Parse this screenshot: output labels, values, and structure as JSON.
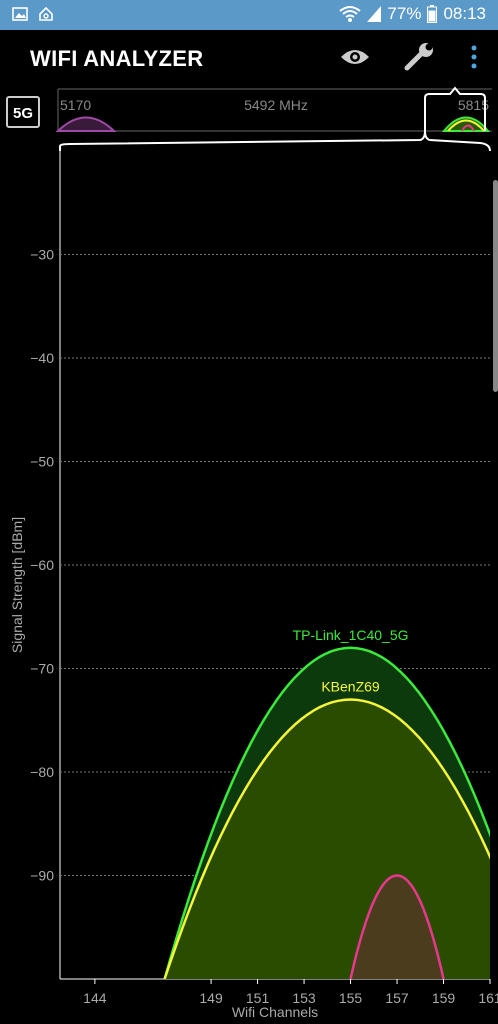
{
  "status_bar": {
    "battery": "77%",
    "time": "08:13",
    "icons": [
      "image-icon",
      "home-screen-icon",
      "wifi-icon",
      "signal-icon",
      "battery-icon"
    ]
  },
  "app": {
    "title": "WIFI ANALYZER",
    "band": "5G",
    "actions": [
      "eye-icon",
      "wrench-icon",
      "more-vert-icon"
    ]
  },
  "overview": {
    "left_label": "5170",
    "center_label": "5492 MHz",
    "right_label": "5815"
  },
  "colors": {
    "green": "#3bea3b",
    "yellow": "#f5f53a",
    "pink": "#e8378d",
    "purple": "#a04aa8"
  },
  "chart_data": {
    "type": "area",
    "xlabel": "Wifi Channels",
    "ylabel": "Signal Strength [dBm]",
    "xlim": [
      142.5,
      161
    ],
    "ylim": [
      -100,
      -20
    ],
    "x_ticks": [
      144,
      149,
      151,
      153,
      155,
      157,
      159,
      161
    ],
    "y_ticks": [
      -30,
      -40,
      -50,
      -60,
      -70,
      -80,
      -90
    ],
    "grid": true,
    "series": [
      {
        "name": "TP-Link_1C40_5G",
        "center": 155,
        "start": 147,
        "end": 163,
        "peak": -68,
        "color": "#3bea3b",
        "fill": "#0c3a0c"
      },
      {
        "name": "KBenZ69",
        "center": 155,
        "start": 147,
        "end": 163,
        "peak": -73,
        "color": "#f5f53a",
        "fill": "#2a4c00"
      },
      {
        "name": "",
        "center": 157,
        "start": 155,
        "end": 159,
        "peak": -90,
        "color": "#e8378d",
        "fill": "#4a3c1c"
      }
    ]
  }
}
